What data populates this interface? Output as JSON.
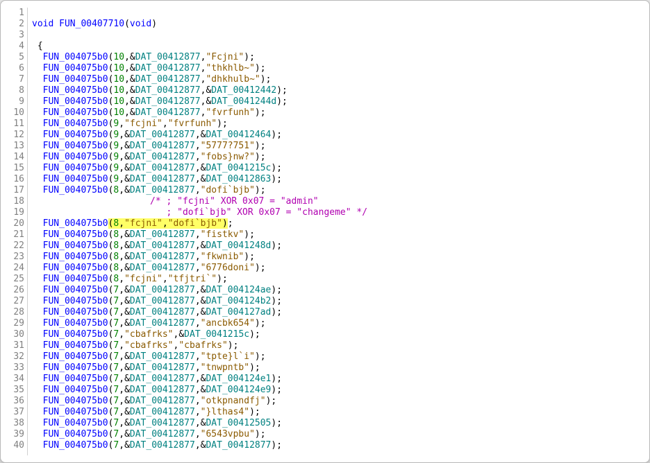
{
  "function_name": "FUN_00407710",
  "return_type": "void",
  "param_type": "void",
  "callee": "FUN_004075b0",
  "dat_common": "DAT_00412877",
  "comment_line1": "/* ; \"fcjni\" XOR 0x07 = \"admin\"",
  "comment_line2": "   ; \"dofi`bjb\" XOR 0x07 = \"changeme\" */",
  "lines": [
    {
      "n": 1,
      "blank": true
    },
    {
      "n": 2,
      "sig": true
    },
    {
      "n": 3,
      "blank": true
    },
    {
      "n": 4,
      "open_brace": true
    },
    {
      "n": 5,
      "a": "10",
      "b_dat": "DAT_00412877",
      "c_str": "\"Fcjni\""
    },
    {
      "n": 6,
      "a": "10",
      "b_dat": "DAT_00412877",
      "c_str": "\"thkhlb~\""
    },
    {
      "n": 7,
      "a": "10",
      "b_dat": "DAT_00412877",
      "c_str": "\"dhkhulb~\""
    },
    {
      "n": 8,
      "a": "10",
      "b_dat": "DAT_00412877",
      "c_dat": "DAT_00412442"
    },
    {
      "n": 9,
      "a": "10",
      "b_dat": "DAT_00412877",
      "c_dat": "DAT_0041244d"
    },
    {
      "n": 10,
      "a": "10",
      "b_dat": "DAT_00412877",
      "c_str": "\"fvrfunh\""
    },
    {
      "n": 11,
      "a": "9",
      "b_str": "\"fcjni\"",
      "c_str": "\"fvrfunh\""
    },
    {
      "n": 12,
      "a": "9",
      "b_dat": "DAT_00412877",
      "c_dat": "DAT_00412464"
    },
    {
      "n": 13,
      "a": "9",
      "b_dat": "DAT_00412877",
      "c_str": "\"5777?751\""
    },
    {
      "n": 14,
      "a": "9",
      "b_dat": "DAT_00412877",
      "c_str": "\"fobs}nw?\""
    },
    {
      "n": 15,
      "a": "9",
      "b_dat": "DAT_00412877",
      "c_dat": "DAT_0041215c"
    },
    {
      "n": 16,
      "a": "9",
      "b_dat": "DAT_00412877",
      "c_dat": "DAT_00412863"
    },
    {
      "n": 17,
      "a": "8",
      "b_dat": "DAT_00412877",
      "c_str": "\"dofi`bjb\""
    },
    {
      "n": 18,
      "comment": 1
    },
    {
      "n": 19,
      "comment": 2
    },
    {
      "n": 20,
      "a": "8",
      "b_str": "\"fcjni\"",
      "c_str": "\"dofi`bjb\"",
      "highlight": true
    },
    {
      "n": 21,
      "a": "8",
      "b_dat": "DAT_00412877",
      "c_str": "\"fistkv\""
    },
    {
      "n": 22,
      "a": "8",
      "b_dat": "DAT_00412877",
      "c_dat": "DAT_0041248d"
    },
    {
      "n": 23,
      "a": "8",
      "b_dat": "DAT_00412877",
      "c_str": "\"fkwnib\""
    },
    {
      "n": 24,
      "a": "8",
      "b_dat": "DAT_00412877",
      "c_str": "\"6776doni\""
    },
    {
      "n": 25,
      "a": "8",
      "b_str": "\"fcjni\"",
      "c_str": "\"tfjtri`\""
    },
    {
      "n": 26,
      "a": "7",
      "b_dat": "DAT_00412877",
      "c_dat": "DAT_004124ae"
    },
    {
      "n": 27,
      "a": "7",
      "b_dat": "DAT_00412877",
      "c_dat": "DAT_004124b2"
    },
    {
      "n": 28,
      "a": "7",
      "b_dat": "DAT_00412877",
      "c_dat": "DAT_004127ad"
    },
    {
      "n": 29,
      "a": "7",
      "b_dat": "DAT_00412877",
      "c_str": "\"ancbk654\""
    },
    {
      "n": 30,
      "a": "7",
      "b_str": "\"cbafrks\"",
      "c_dat": "DAT_0041215c"
    },
    {
      "n": 31,
      "a": "7",
      "b_str": "\"cbafrks\"",
      "c_str": "\"cbafrks\""
    },
    {
      "n": 32,
      "a": "7",
      "b_dat": "DAT_00412877",
      "c_str": "\"tpte}l`i\""
    },
    {
      "n": 33,
      "a": "7",
      "b_dat": "DAT_00412877",
      "c_str": "\"tnwpntb\""
    },
    {
      "n": 34,
      "a": "7",
      "b_dat": "DAT_00412877",
      "c_dat": "DAT_004124e1"
    },
    {
      "n": 35,
      "a": "7",
      "b_dat": "DAT_00412877",
      "c_dat": "DAT_004124e9"
    },
    {
      "n": 36,
      "a": "7",
      "b_dat": "DAT_00412877",
      "c_str": "\"otkpnandfj\""
    },
    {
      "n": 37,
      "a": "7",
      "b_dat": "DAT_00412877",
      "c_str": "\"}lthas4\""
    },
    {
      "n": 38,
      "a": "7",
      "b_dat": "DAT_00412877",
      "c_dat": "DAT_00412505"
    },
    {
      "n": 39,
      "a": "7",
      "b_dat": "DAT_00412877",
      "c_str": "\"6543vpbu\""
    },
    {
      "n": 40,
      "a": "7",
      "b_dat": "DAT_00412877",
      "c_dat": "DAT_00412877"
    }
  ]
}
